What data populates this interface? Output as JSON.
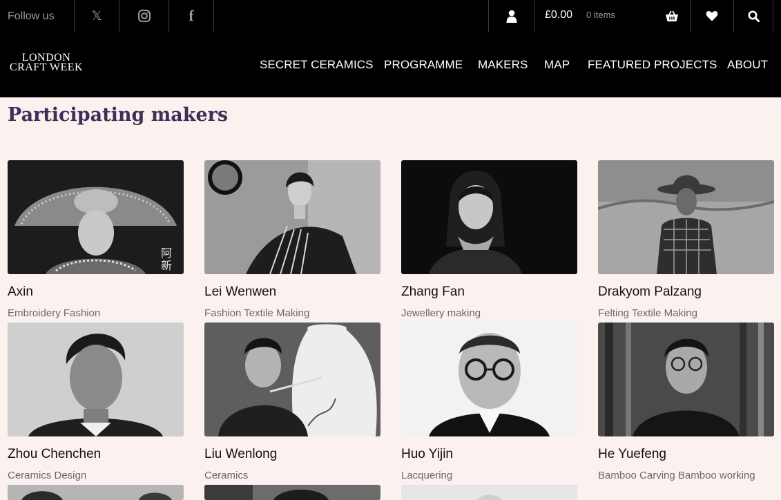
{
  "topbar": {
    "follow_label": "Follow us",
    "cart_total": "£0.00",
    "cart_items": "0 items"
  },
  "logo": {
    "line1": "LONDON",
    "line2": "CRAFT WEEK"
  },
  "nav": [
    "SECRET CERAMICS",
    "PROGRAMME",
    "MAKERS",
    "MAP",
    "FEATURED PROJECTS",
    "ABOUT"
  ],
  "page": {
    "title": "Participating makers"
  },
  "makers": [
    {
      "name": "Axin",
      "craft": "Embroidery Fashion"
    },
    {
      "name": "Lei Wenwen",
      "craft": "Fashion Textile Making"
    },
    {
      "name": "Zhang Fan",
      "craft": "Jewellery making"
    },
    {
      "name": "Drakyom Palzang",
      "craft": "Felting Textile Making"
    },
    {
      "name": "Zhou Chenchen",
      "craft": "Ceramics Design"
    },
    {
      "name": "Liu Wenlong",
      "craft": "Ceramics"
    },
    {
      "name": "Huo Yijin",
      "craft": "Lacquering"
    },
    {
      "name": "He Yuefeng",
      "craft": "Bamboo Carving Bamboo working"
    }
  ],
  "icons": {
    "twitter": "x-icon",
    "instagram": "instagram-icon",
    "facebook": "facebook-icon",
    "account": "user-icon",
    "basket": "basket-icon",
    "wishlist": "heart-icon",
    "search": "search-icon"
  },
  "colors": {
    "bar": "#000000",
    "page_bg": "#fbf1ef",
    "heading": "#3f2f58"
  }
}
